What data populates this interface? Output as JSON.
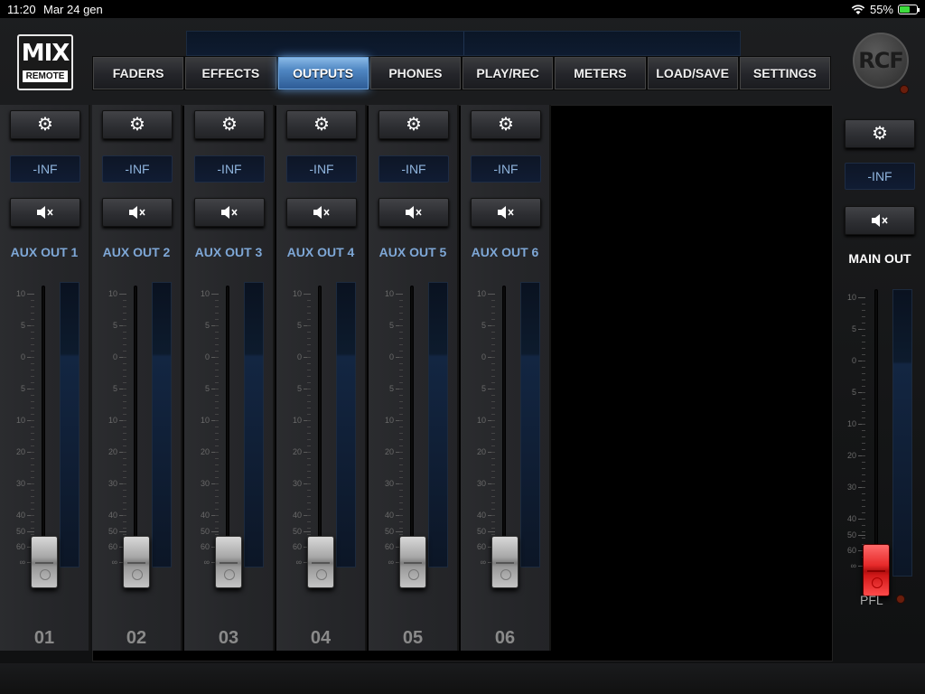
{
  "status_bar": {
    "time": "11:20",
    "date": "Mar 24 gen",
    "battery": "55%"
  },
  "logo": {
    "big": "MIX",
    "small": "REMOTE"
  },
  "brand": "RCF",
  "tabs": [
    {
      "label": "FADERS",
      "active": false
    },
    {
      "label": "EFFECTS",
      "active": false
    },
    {
      "label": "OUTPUTS",
      "active": true
    },
    {
      "label": "PHONES",
      "active": false
    },
    {
      "label": "PLAY/REC",
      "active": false
    },
    {
      "label": "METERS",
      "active": false
    },
    {
      "label": "LOAD/SAVE",
      "active": false
    },
    {
      "label": "SETTINGS",
      "active": false
    }
  ],
  "strips": [
    {
      "name": "AUX OUT 1",
      "level": "-INF",
      "number": "01"
    },
    {
      "name": "AUX OUT 2",
      "level": "-INF",
      "number": "02"
    },
    {
      "name": "AUX OUT 3",
      "level": "-INF",
      "number": "03"
    },
    {
      "name": "AUX OUT 4",
      "level": "-INF",
      "number": "04"
    },
    {
      "name": "AUX OUT 5",
      "level": "-INF",
      "number": "05"
    },
    {
      "name": "AUX OUT 6",
      "level": "-INF",
      "number": "06"
    }
  ],
  "scale_labels": [
    "10",
    "5",
    "0",
    "5",
    "10",
    "20",
    "30",
    "40",
    "50",
    "60",
    "∞"
  ],
  "main_out": {
    "name": "MAIN OUT",
    "level": "-INF",
    "pfl_label": "PFL"
  },
  "icons": {
    "settings": "gear-icon",
    "mute": "speaker-mute-icon"
  },
  "colors": {
    "accent": "#4f86c2",
    "strip_label": "#7ea7d6",
    "main_fader": "#e62a2a"
  }
}
